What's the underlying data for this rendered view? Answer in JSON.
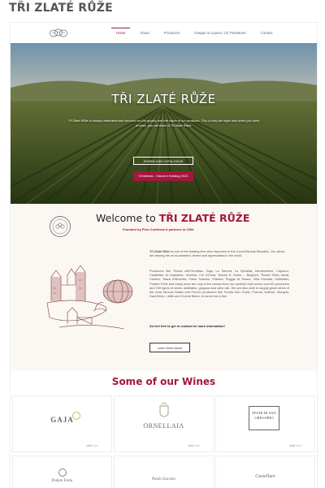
{
  "page_title": "TŘI ZLATÉ RŮŽE",
  "nav": {
    "logo_icon": "rose-logo-icon",
    "items": [
      {
        "label": "Home",
        "active": true
      },
      {
        "label": "About",
        "active": false
      },
      {
        "label": "Producers",
        "active": false
      },
      {
        "label": "Grappe & Liquors, Oil, Panettone",
        "active": false
      },
      {
        "label": "Contact",
        "active": false
      }
    ]
  },
  "hero": {
    "title": "TŘI ZLATÉ RŮŽE",
    "text": "Tři Zlaté Růže is always dedicated and focused on the quality and the value of our products. This is why we hope that when you think of wine, you will think of Tři Zlaté Růže.",
    "download_label": "DOWNLOAD CATALOGUE",
    "christmas_label": "Christmas - Vánoční Katalog 2022"
  },
  "welcome": {
    "heading_prefix": "Welcome to",
    "heading_brand": "TŘI ZLATÉ RŮŽE",
    "founded": "Founded by Pino Confessa & partners in 1994",
    "p1_brand": "Tři Zlaté Růže",
    "p1_rest": " is one of the leading fine wine importers in the Czech/Slovak Republic. Our wines are among the most awarded, tested and appreciated in the world.",
    "p2": "Producers like Tenuta dell'Ornellaia, Gaja, La Serena, La Spinetta, Montevertine, Caparzo, Castellare di Castellina, Vecchia, Col d'Orcia, Tenuta S. Guido – Bolgheri, Tenute Silvio Nardi, Ceretto, Tasca d'Almerita, Paolo Scavino, Planeta, Poggio al Tesoro, Villa Favorita, Hofstätter, Podere Forte and many more are only a few names from our portfolio that covers over 60 producers and 100 types of wines, distillates, grappas and olive oils. We are also able to supply great wines of the most famous Italian and French producers like Tenuta San Guido, Petrolo, Antinori, Marquis, Haut Brion, Lafite and Cheval Blanc, to name but a few.",
    "p3": "So feel free to get in contact for more information!",
    "learn_label": "Learn More About"
  },
  "wines": {
    "heading": "Some of our Wines",
    "visit_label": "visit >>>",
    "cards": [
      {
        "name": "GAJA"
      },
      {
        "name": "ORNELLAIA"
      },
      {
        "name": "FEUDI DI SAN GREGORIO"
      },
      {
        "name": "Podere Forte"
      },
      {
        "name": "Paolo Scavino"
      },
      {
        "name": "Castellare"
      }
    ]
  },
  "colors": {
    "accent": "#a3173e"
  }
}
